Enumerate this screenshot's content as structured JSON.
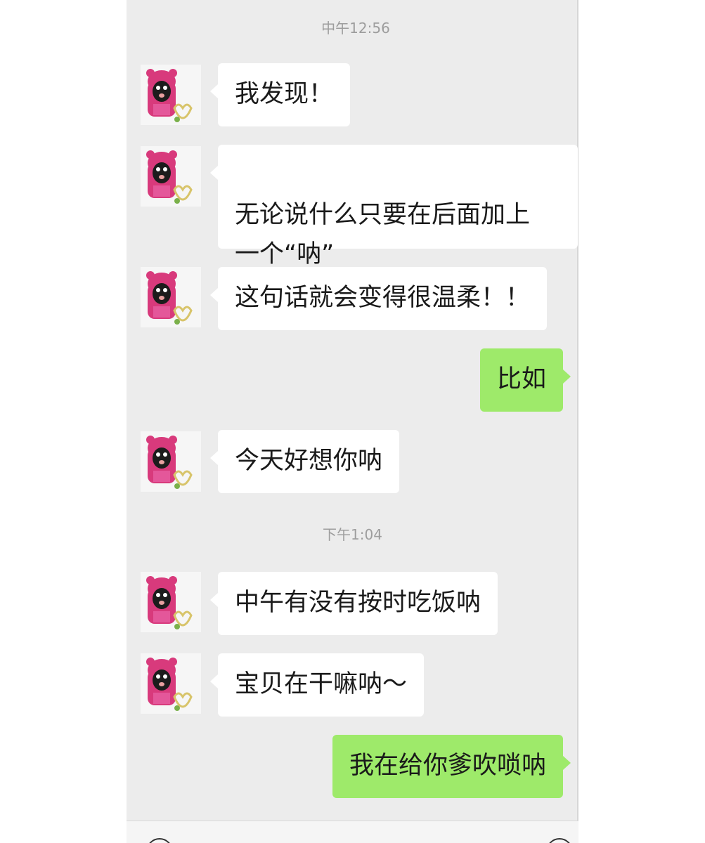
{
  "timestamps": [
    "中午12:56",
    "下午1:04"
  ],
  "messages": [
    {
      "text": "我发现！"
    },
    {
      "text": "无论说什么只要在后面加上\n一个“呐”"
    },
    {
      "text": "这句话就会变得很温柔！！"
    },
    {
      "text": "比如"
    },
    {
      "text": "今天好想你呐"
    },
    {
      "text": "中午有没有按时吃饭呐"
    },
    {
      "text": "宝贝在干嘛呐～"
    },
    {
      "text": "我在给你爹吹唢呐"
    }
  ],
  "colors": {
    "background": "#ececec",
    "incoming_bubble": "#ffffff",
    "outgoing_bubble": "#9eea6a",
    "timestamp": "#9d9d9d"
  }
}
